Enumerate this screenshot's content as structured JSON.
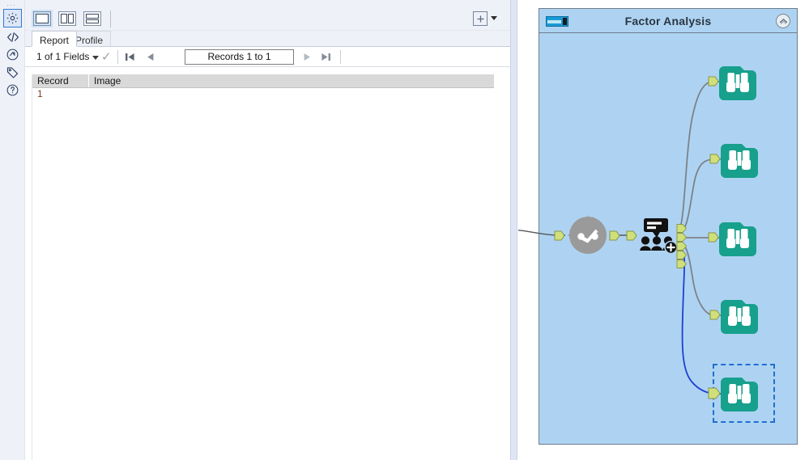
{
  "app": {
    "accent_blue": "#2f7bd4",
    "canvas_bg": "#aed3f2",
    "browse_teal": "#17a08c",
    "anchor_green": "#cfe07a",
    "selection_blue": "#1f6fd0"
  },
  "results_panel": {
    "icon_rail": {
      "drag_dots": "···",
      "items": [
        {
          "name": "settings-gear-icon",
          "label": "Settings",
          "selected": true
        },
        {
          "name": "code-brackets-icon",
          "label": "XML View",
          "selected": false
        },
        {
          "name": "refresh-circle-icon",
          "label": "Run / Refresh",
          "selected": false
        },
        {
          "name": "tag-icon",
          "label": "Annotation",
          "selected": false
        },
        {
          "name": "help-question-icon",
          "label": "Help",
          "selected": false
        }
      ]
    },
    "toolbar": {
      "layout_buttons": [
        {
          "name": "layout-single-pane",
          "label": "Single Pane",
          "selected": true
        },
        {
          "name": "layout-split-vertical",
          "label": "Split Vertical",
          "selected": false
        },
        {
          "name": "layout-split-horizontal",
          "label": "Split Horizontal",
          "selected": false
        }
      ],
      "add_view_label": "Add View",
      "add_view_icon": "plus-box-icon",
      "add_view_caret_icon": "chevron-down-icon"
    },
    "tabs": [
      {
        "label": "Report",
        "active": true
      },
      {
        "label": "Profile",
        "active": false
      }
    ],
    "record_nav": {
      "fields_label": "1 of 1 Fields",
      "fields_caret_icon": "chevron-down-icon",
      "fields_check_icon": "check-icon",
      "first_label": "First Record",
      "prev_label": "Previous Record",
      "records_value": "Records 1 to 1",
      "next_label": "Next Record",
      "last_label": "Last Record"
    },
    "table": {
      "columns": [
        "Record",
        "Image"
      ],
      "rows": [
        {
          "record": "1",
          "image": ""
        }
      ]
    }
  },
  "canvas": {
    "container": {
      "title": "Factor Analysis",
      "icon": "container-tool-icon",
      "collapse_icon": "chevron-up-icon",
      "collapse_label": "Collapse Container"
    },
    "nodes": [
      {
        "name": "tool-node-gear",
        "icon": "gear-check-icon",
        "label": "Macro Tool"
      },
      {
        "name": "tool-node-factor-analysis",
        "icon": "group-speech-plus-icon",
        "label": "Factor Analysis Tool"
      },
      {
        "name": "tool-node-browse-1",
        "icon": "binoculars-icon",
        "label": "Browse",
        "selected": false
      },
      {
        "name": "tool-node-browse-2",
        "icon": "binoculars-icon",
        "label": "Browse",
        "selected": false
      },
      {
        "name": "tool-node-browse-3",
        "icon": "binoculars-icon",
        "label": "Browse",
        "selected": false
      },
      {
        "name": "tool-node-browse-4",
        "icon": "binoculars-icon",
        "label": "Browse",
        "selected": false
      },
      {
        "name": "tool-node-browse-5",
        "icon": "binoculars-icon",
        "label": "Browse",
        "selected": true
      }
    ],
    "connections": [
      {
        "name": "connection-incoming",
        "color": "#55595c",
        "selected": false
      },
      {
        "name": "connection-gear-to-factor",
        "color": "#55595c",
        "selected": false
      },
      {
        "name": "connection-out-1",
        "color": "#7b8289",
        "selected": false
      },
      {
        "name": "connection-out-2",
        "color": "#7b8289",
        "selected": false
      },
      {
        "name": "connection-out-3",
        "color": "#7b8289",
        "selected": false
      },
      {
        "name": "connection-out-4",
        "color": "#7b8289",
        "selected": false
      },
      {
        "name": "connection-out-5",
        "color": "#1f3fd0",
        "selected": true
      }
    ]
  }
}
